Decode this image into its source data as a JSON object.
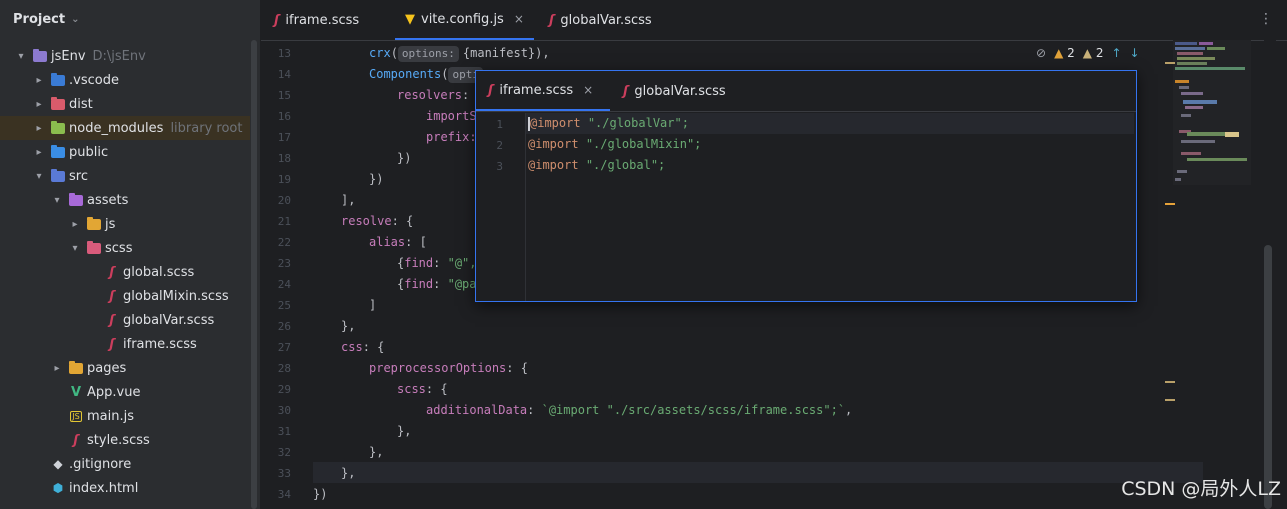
{
  "project_panel": {
    "title": "Project",
    "tree": [
      {
        "label": "jsEnv",
        "sub": "D:\\jsEnv",
        "depth": 0,
        "arrow": "open",
        "icon": "module-folder-icon"
      },
      {
        "label": ".vscode",
        "sub": "",
        "depth": 1,
        "arrow": "closed",
        "icon": "vscode-folder-icon"
      },
      {
        "label": "dist",
        "sub": "",
        "depth": 1,
        "arrow": "closed",
        "icon": "dist-folder-icon"
      },
      {
        "label": "node_modules",
        "sub": "library root",
        "depth": 1,
        "arrow": "closed",
        "icon": "node-modules-folder-icon"
      },
      {
        "label": "public",
        "sub": "",
        "depth": 1,
        "arrow": "closed",
        "icon": "public-folder-icon"
      },
      {
        "label": "src",
        "sub": "",
        "depth": 1,
        "arrow": "open",
        "icon": "source-folder-icon"
      },
      {
        "label": "assets",
        "sub": "",
        "depth": 2,
        "arrow": "open",
        "icon": "assets-folder-icon"
      },
      {
        "label": "js",
        "sub": "",
        "depth": 3,
        "arrow": "closed",
        "icon": "js-folder-icon"
      },
      {
        "label": "scss",
        "sub": "",
        "depth": 3,
        "arrow": "open",
        "icon": "scss-folder-icon"
      },
      {
        "label": "global.scss",
        "sub": "",
        "depth": 4,
        "arrow": "none",
        "icon": "scss-file-icon"
      },
      {
        "label": "globalMixin.scss",
        "sub": "",
        "depth": 4,
        "arrow": "none",
        "icon": "scss-file-icon"
      },
      {
        "label": "globalVar.scss",
        "sub": "",
        "depth": 4,
        "arrow": "none",
        "icon": "scss-file-icon"
      },
      {
        "label": "iframe.scss",
        "sub": "",
        "depth": 4,
        "arrow": "none",
        "icon": "scss-file-icon"
      },
      {
        "label": "pages",
        "sub": "",
        "depth": 2,
        "arrow": "closed",
        "icon": "pages-folder-icon"
      },
      {
        "label": "App.vue",
        "sub": "",
        "depth": 2,
        "arrow": "none",
        "icon": "vue-file-icon"
      },
      {
        "label": "main.js",
        "sub": "",
        "depth": 2,
        "arrow": "none",
        "icon": "js-file-icon"
      },
      {
        "label": "style.scss",
        "sub": "",
        "depth": 2,
        "arrow": "none",
        "icon": "scss-file-icon"
      },
      {
        "label": ".gitignore",
        "sub": "",
        "depth": 1,
        "arrow": "none",
        "icon": "gitignore-file-icon"
      },
      {
        "label": "index.html",
        "sub": "",
        "depth": 1,
        "arrow": "none",
        "icon": "html-file-icon"
      }
    ]
  },
  "editor": {
    "tabs": [
      {
        "label": "iframe.scss",
        "active": false,
        "icon": "scss-file-icon"
      },
      {
        "label": "vite.config.js",
        "active": true,
        "icon": "vite-file-icon",
        "close": "×"
      },
      {
        "label": "globalVar.scss",
        "active": false,
        "icon": "scss-file-icon"
      }
    ],
    "inspection": {
      "warnings": "2",
      "weak_warnings": "2"
    },
    "line_numbers": [
      "13",
      "14",
      "15",
      "16",
      "17",
      "18",
      "19",
      "20",
      "21",
      "22",
      "23",
      "24",
      "25",
      "26",
      "27",
      "28",
      "29",
      "30",
      "31",
      "32",
      "33",
      "34"
    ],
    "hints": {
      "crx": "options:",
      "components": "opti"
    },
    "code": {
      "l13_fn": "crx",
      "l13_rest": "{manifest}),",
      "l14_fn": "Components",
      "l15_prop": "resolvers",
      "l16_text": "importS",
      "l17_prop": "prefix:",
      "l18": "})",
      "l19": "})",
      "l20": "],",
      "l21_prop": "resolve",
      "l22_prop": "alias",
      "l23_prop": "find",
      "l23_str": "\"@\",",
      "l24_prop": "find",
      "l24_str": "\"@pa",
      "l25": "]",
      "l26": "},",
      "l27_prop": "css",
      "l28_prop": "preprocessorOptions",
      "l29_prop": "scss",
      "l30_prop": "additionalData",
      "l30_str": "`@import \"./src/assets/scss/iframe.scss\";`",
      "l31": "},",
      "l32": "},",
      "l33": "},",
      "l34": "})"
    }
  },
  "popup": {
    "tabs": [
      {
        "label": "iframe.scss",
        "close": "×",
        "active": true
      },
      {
        "label": "globalVar.scss",
        "active": false
      }
    ],
    "line_numbers": [
      "1",
      "2",
      "3"
    ],
    "lines": [
      {
        "kw": "@import",
        "str": "\"./globalVar\";"
      },
      {
        "kw": "@import",
        "str": "\"./globalMixin\";"
      },
      {
        "kw": "@import",
        "str": "\"./global\";"
      }
    ]
  },
  "watermark": "CSDN @局外人LZ",
  "colors": {
    "accent": "#3574f0",
    "scss": "#cc3e5d",
    "keyword": "#cf8e6d",
    "property": "#c77dbb",
    "string": "#6aab73",
    "function": "#57aaf7"
  }
}
